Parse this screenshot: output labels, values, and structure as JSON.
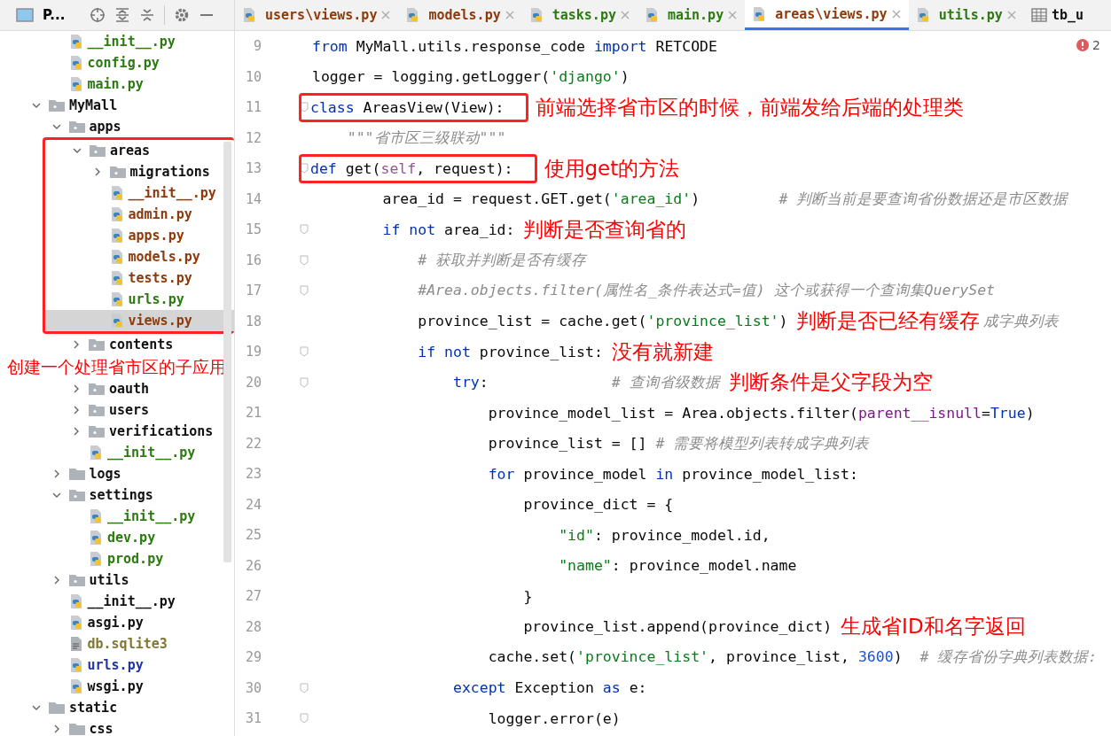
{
  "project_panel": {
    "title": "P..."
  },
  "tabs": [
    {
      "label": "users\\views.py",
      "kind": "python",
      "color": "#8f3a0a",
      "selected": false
    },
    {
      "label": "models.py",
      "kind": "python",
      "color": "#8f3a0a",
      "selected": false
    },
    {
      "label": "tasks.py",
      "kind": "python",
      "color": "#2d7a12",
      "selected": false
    },
    {
      "label": "main.py",
      "kind": "python",
      "color": "#2d7a12",
      "selected": false
    },
    {
      "label": "areas\\views.py",
      "kind": "python",
      "color": "#8f3a0a",
      "selected": true
    },
    {
      "label": "utils.py",
      "kind": "python",
      "color": "#2d7a12",
      "selected": false
    },
    {
      "label": "tb_u",
      "kind": "table",
      "color": "#111111",
      "selected": false
    }
  ],
  "tree": {
    "above": [
      {
        "name": "__init__.py",
        "kind": "python",
        "color": "#2d7a12",
        "selected": false
      },
      {
        "name": "config.py",
        "kind": "python",
        "color": "#2d7a12",
        "selected": false
      },
      {
        "name": "main.py",
        "kind": "python",
        "color": "#2d7a12",
        "selected": false
      }
    ],
    "roots": [
      {
        "name": "MyMall",
        "kind": "package",
        "expanded": true,
        "selected": false,
        "children": [
          {
            "name": "apps",
            "kind": "package",
            "expanded": true,
            "selected": false,
            "children": [
              {
                "name": "areas",
                "kind": "package",
                "expanded": true,
                "selected": false,
                "highlighted": true,
                "children": [
                  {
                    "name": "migrations",
                    "kind": "package",
                    "expanded": false,
                    "selected": false
                  },
                  {
                    "name": "__init__.py",
                    "kind": "python",
                    "color": "#8f3a0a",
                    "selected": false
                  },
                  {
                    "name": "admin.py",
                    "kind": "python",
                    "color": "#8f3a0a",
                    "selected": false
                  },
                  {
                    "name": "apps.py",
                    "kind": "python",
                    "color": "#8f3a0a",
                    "selected": false
                  },
                  {
                    "name": "models.py",
                    "kind": "python",
                    "color": "#8f3a0a",
                    "selected": false
                  },
                  {
                    "name": "tests.py",
                    "kind": "python",
                    "color": "#8f3a0a",
                    "selected": false
                  },
                  {
                    "name": "urls.py",
                    "kind": "python",
                    "color": "#2d7a12",
                    "selected": false
                  },
                  {
                    "name": "views.py",
                    "kind": "python",
                    "color": "#8f3a0a",
                    "selected": true
                  }
                ]
              },
              {
                "name": "contents",
                "kind": "package",
                "expanded": false,
                "selected": false
              },
              {
                "kind": "note",
                "text": "创建一个处理省市区的子应用"
              },
              {
                "name": "oauth",
                "kind": "package",
                "expanded": false,
                "selected": false
              },
              {
                "name": "users",
                "kind": "package",
                "expanded": false,
                "selected": false
              },
              {
                "name": "verifications",
                "kind": "package",
                "expanded": false,
                "selected": false
              },
              {
                "name": "__init__.py",
                "kind": "python",
                "color": "#2d7a12",
                "selected": false
              }
            ]
          },
          {
            "name": "logs",
            "kind": "folder",
            "expanded": false,
            "selected": false
          },
          {
            "name": "settings",
            "kind": "package",
            "expanded": true,
            "selected": false,
            "children": [
              {
                "name": "__init__.py",
                "kind": "python",
                "color": "#2d7a12",
                "selected": false
              },
              {
                "name": "dev.py",
                "kind": "python",
                "color": "#2d7a12",
                "selected": false
              },
              {
                "name": "prod.py",
                "kind": "python",
                "color": "#2d7a12",
                "selected": false
              }
            ]
          },
          {
            "name": "utils",
            "kind": "package",
            "expanded": false,
            "selected": false
          },
          {
            "name": "__init__.py",
            "kind": "python",
            "color": "#111111",
            "selected": false
          },
          {
            "name": "asgi.py",
            "kind": "python",
            "color": "#111111",
            "selected": false
          },
          {
            "name": "db.sqlite3",
            "kind": "text",
            "color": "#7f7832",
            "selected": false
          },
          {
            "name": "urls.py",
            "kind": "python",
            "color": "#2235a8",
            "selected": false
          },
          {
            "name": "wsgi.py",
            "kind": "python",
            "color": "#111111",
            "selected": false
          }
        ]
      },
      {
        "name": "static",
        "kind": "folder",
        "expanded": true,
        "selected": false,
        "children": [
          {
            "name": "css",
            "kind": "folder",
            "expanded": false,
            "selected": false
          }
        ]
      }
    ]
  },
  "editor": {
    "error_count": "2",
    "lines": [
      {
        "number": "9",
        "segments": [
          {
            "t": "from",
            "kind": "kw"
          },
          {
            "t": " MyMall.utils.response_code ",
            "kind": "plain"
          },
          {
            "t": "import",
            "kind": "kw"
          },
          {
            "t": " RETCODE",
            "kind": "plain"
          }
        ]
      },
      {
        "number": "10",
        "segments": [
          {
            "t": "logger = logging.getLogger(",
            "kind": "plain"
          },
          {
            "t": "'django'",
            "kind": "str"
          },
          {
            "t": ")",
            "kind": "plain"
          }
        ]
      },
      {
        "number": "11",
        "fold": true,
        "boxed": true,
        "segments": [
          {
            "t": "class",
            "kind": "kw"
          },
          {
            "t": " AreasView(View):",
            "kind": "plain"
          }
        ],
        "annotation": "前端选择省市区的时候，前端发给后端的处理类"
      },
      {
        "number": "12",
        "segments": [
          {
            "t": "    \"\"\"省市区三级联动\"\"\"",
            "kind": "doc"
          }
        ]
      },
      {
        "number": "13",
        "fold": true,
        "boxed": true,
        "segments": [
          {
            "t": "def",
            "kind": "kw"
          },
          {
            "t": " get(",
            "kind": "plain"
          },
          {
            "t": "self",
            "kind": "self"
          },
          {
            "t": ", request):",
            "kind": "plain"
          }
        ],
        "annotation": "使用get的方法"
      },
      {
        "number": "14",
        "segments": [
          {
            "t": "        area_id = request.GET.get(",
            "kind": "plain"
          },
          {
            "t": "'area_id'",
            "kind": "str"
          },
          {
            "t": ")         ",
            "kind": "plain"
          },
          {
            "t": "# 判断当前是要查询省份数据还是市区数据",
            "kind": "cmt"
          }
        ]
      },
      {
        "number": "15",
        "fold": true,
        "segments": [
          {
            "t": "        if not",
            "kind": "kw"
          },
          {
            "t": " area_id:",
            "kind": "plain"
          }
        ],
        "annotation": "判断是否查询省的"
      },
      {
        "number": "16",
        "fold": true,
        "segments": [
          {
            "t": "            # 获取并判断是否有缓存",
            "kind": "cmt"
          }
        ]
      },
      {
        "number": "17",
        "fold": true,
        "segments": [
          {
            "t": "            #Area.objects.filter(属性名_条件表达式=值) 这个或获得一个查询集QuerySet",
            "kind": "cmt"
          }
        ]
      },
      {
        "number": "18",
        "segments": [
          {
            "t": "            province_list = cache.get(",
            "kind": "plain"
          },
          {
            "t": "'province_list'",
            "kind": "str"
          },
          {
            "t": ")",
            "kind": "plain"
          }
        ],
        "annotation": "判断是否已经有缓存",
        "tail": "成字典列表"
      },
      {
        "number": "19",
        "fold": true,
        "segments": [
          {
            "t": "            if not",
            "kind": "kw"
          },
          {
            "t": " province_list:",
            "kind": "plain"
          }
        ],
        "annotation": "没有就新建"
      },
      {
        "number": "20",
        "fold": true,
        "segments": [
          {
            "t": "                try",
            "kind": "kw"
          },
          {
            "t": ":              ",
            "kind": "plain"
          },
          {
            "t": "# 查询省级数据",
            "kind": "cmt"
          }
        ],
        "annotation": "判断条件是父字段为空"
      },
      {
        "number": "21",
        "segments": [
          {
            "t": "                    province_model_list = Area.objects.filter(",
            "kind": "plain"
          },
          {
            "t": "parent__isnull",
            "kind": "param"
          },
          {
            "t": "=",
            "kind": "plain"
          },
          {
            "t": "True",
            "kind": "kw"
          },
          {
            "t": ")",
            "kind": "plain"
          }
        ]
      },
      {
        "number": "22",
        "segments": [
          {
            "t": "                    province_list = [] ",
            "kind": "plain"
          },
          {
            "t": "# 需要将模型列表转成字典列表",
            "kind": "cmt"
          }
        ]
      },
      {
        "number": "23",
        "segments": [
          {
            "t": "                    for",
            "kind": "kw"
          },
          {
            "t": " province_model ",
            "kind": "plain"
          },
          {
            "t": "in",
            "kind": "kw"
          },
          {
            "t": " province_model_list:",
            "kind": "plain"
          }
        ]
      },
      {
        "number": "24",
        "segments": [
          {
            "t": "                        province_dict = {",
            "kind": "plain"
          }
        ]
      },
      {
        "number": "25",
        "segments": [
          {
            "t": "                            \"id\"",
            "kind": "str"
          },
          {
            "t": ": province_model.id,",
            "kind": "plain"
          }
        ]
      },
      {
        "number": "26",
        "segments": [
          {
            "t": "                            \"name\"",
            "kind": "str"
          },
          {
            "t": ": province_model.name",
            "kind": "plain"
          }
        ]
      },
      {
        "number": "27",
        "segments": [
          {
            "t": "                        }",
            "kind": "plain"
          }
        ]
      },
      {
        "number": "28",
        "segments": [
          {
            "t": "                        province_list.append(province_dict)",
            "kind": "plain"
          }
        ],
        "annotation": "生成省ID和名字返回"
      },
      {
        "number": "29",
        "segments": [
          {
            "t": "                    cache.set(",
            "kind": "plain"
          },
          {
            "t": "'province_list'",
            "kind": "str"
          },
          {
            "t": ", province_list, ",
            "kind": "plain"
          },
          {
            "t": "3600",
            "kind": "num"
          },
          {
            "t": ")  ",
            "kind": "plain"
          },
          {
            "t": "# 缓存省份字典列表数据:",
            "kind": "cmt"
          }
        ]
      },
      {
        "number": "30",
        "fold": true,
        "segments": [
          {
            "t": "                except",
            "kind": "kw"
          },
          {
            "t": " Exception ",
            "kind": "plain"
          },
          {
            "t": "as",
            "kind": "kw"
          },
          {
            "t": " e:",
            "kind": "plain"
          }
        ]
      },
      {
        "number": "31",
        "fold": true,
        "segments": [
          {
            "t": "                    logger.error(e)",
            "kind": "plain"
          }
        ]
      }
    ]
  }
}
